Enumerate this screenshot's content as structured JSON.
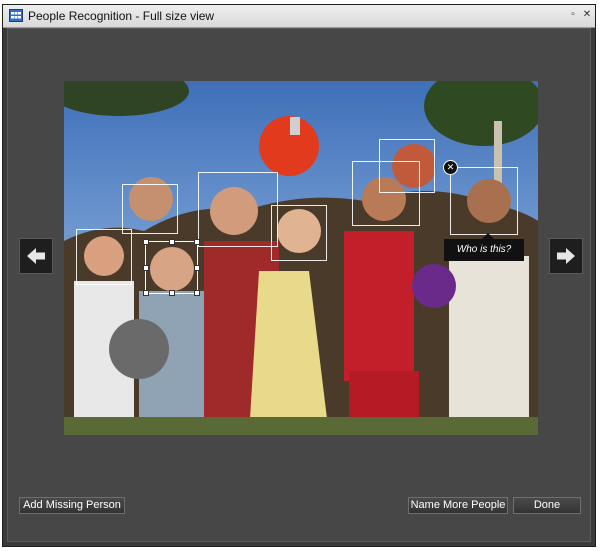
{
  "window": {
    "title": "People Recognition - Full size view",
    "minimize_glyph": "▫",
    "close_glyph": "✕"
  },
  "tooltip": {
    "text": "Who is this?"
  },
  "icons": {
    "app": "grid-icon",
    "prev": "arrow-left-icon",
    "next": "arrow-right-icon",
    "remove_face": "close-icon",
    "remove_glyph": "✕"
  },
  "buttons": {
    "add_missing": "Add Missing Person",
    "name_more": "Name More People",
    "done": "Done"
  },
  "colors": {
    "window_bg": "#474747",
    "tooltip_bg": "#111111",
    "face_box": "#ffffff"
  }
}
